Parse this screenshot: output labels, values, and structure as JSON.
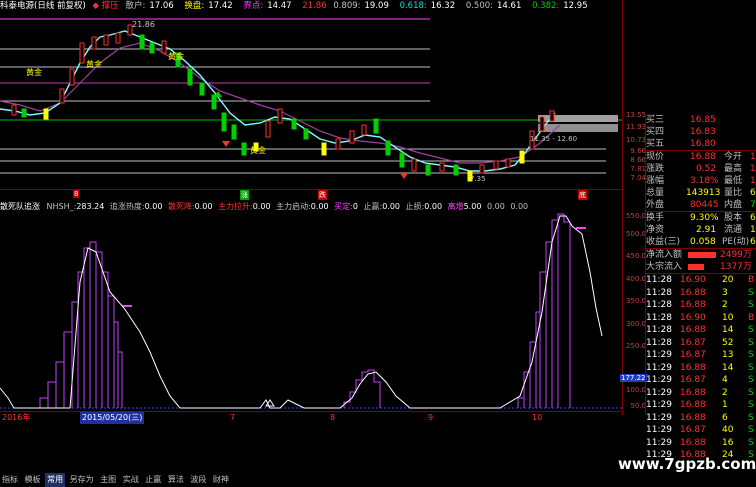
{
  "topbar": {
    "title": "科泰电源(日线 前复权)",
    "pressure": "◆ 撑压",
    "pos_label": "散户:",
    "pos_val": "17.06",
    "chg_label": "换盘:",
    "chg_val": "17.42",
    "line_label": "界点:",
    "line_val": "14.47",
    "ma_val": "21.86",
    "v1_label": "0.809:",
    "v1_val": "19.09",
    "v2_label": "0.618:",
    "v2_val": "16.32",
    "v3_label": "0.500:",
    "v3_val": "14.61",
    "v4_label": "0.382:",
    "v4_val": "12.95"
  },
  "main_chart": {
    "high_label": "21.86",
    "annotations": [
      "黄金",
      "黄金",
      "黄金",
      "黄金"
    ],
    "mid_label": "11.35 - 12.60",
    "low_label": "7.35"
  },
  "signal_row": {
    "sig1": "8",
    "sig2": "涨",
    "sig3": "跌",
    "sig4": "底"
  },
  "indicator": {
    "name": "散死队追涨",
    "nhsh_label": "NHSH_:",
    "nhsh_val": "283.24",
    "heat_label": "追涨热度:",
    "heat_val": "0.00",
    "death_label": "散死降:",
    "death_val": "0.00",
    "pull_label": "主力拉升:",
    "pull_val": "0.00",
    "start_label": "主力启动:",
    "start_val": "0.00",
    "entry_label": "买定:",
    "entry_val": "0",
    "stop_label": "止赢:",
    "stop_val": "0.00",
    "loss_label": "止损:",
    "loss_val": "0.00",
    "fit_label": "离增",
    "fit_val": "5.00",
    "t1": "0.00",
    "t2": "0.00",
    "current_marker": "177.22"
  },
  "price_axis": [
    "13.55",
    "11.93",
    "10.73",
    "9.66",
    "8.66",
    "7.81",
    "7.04"
  ],
  "ind_axis": [
    "550.0",
    "500.0",
    "450.0",
    "400.0",
    "350.0",
    "300.0",
    "250.0",
    "200.0",
    "150.0",
    "100.0",
    "50.0"
  ],
  "date_axis": {
    "year": "2016年",
    "date_box": "2015/05/20(三)",
    "m7": "7",
    "m8": "8",
    "m9": "9",
    "m10": "10"
  },
  "quote_panel": {
    "rows": [
      {
        "label": "买三",
        "value": "16.85",
        "extra": ""
      },
      {
        "label": "买四",
        "value": "16.83",
        "extra": ""
      },
      {
        "label": "买五",
        "value": "16.80",
        "extra": ""
      },
      {
        "label": "现价",
        "value": "16.88",
        "extra": "今开"
      },
      {
        "label": "涨跌",
        "value": "0.52",
        "extra": "最高"
      },
      {
        "label": "涨幅",
        "value": "3.18%",
        "extra": "最低"
      },
      {
        "label": "总量",
        "value": "143913",
        "extra": "量比"
      },
      {
        "label": "外盘",
        "value": "80445",
        "extra": "内盘"
      },
      {
        "label": "换手",
        "value": "9.30%",
        "extra": "股本"
      },
      {
        "label": "净资",
        "value": "2.91",
        "extra": "流通"
      },
      {
        "label": "收益(三)",
        "value": "0.058",
        "extra": "PE(动)"
      },
      {
        "label": "净流入额",
        "value": "2499万",
        "extra": ""
      },
      {
        "label": "大宗流入",
        "value": "1377万",
        "extra": ""
      }
    ],
    "right_edge": [
      "1",
      "1",
      "1",
      "6",
      "7",
      "6",
      "1",
      "6",
      "1",
      "1",
      "1"
    ],
    "trades": [
      {
        "time": "11:28",
        "price": "16.90",
        "vol": "20",
        "side": "B"
      },
      {
        "time": "11:28",
        "price": "16.88",
        "vol": "3",
        "side": "S"
      },
      {
        "time": "11:28",
        "price": "16.88",
        "vol": "2",
        "side": "S"
      },
      {
        "time": "11:28",
        "price": "16.90",
        "vol": "10",
        "side": "B"
      },
      {
        "time": "11:28",
        "price": "16.88",
        "vol": "14",
        "side": "S"
      },
      {
        "time": "11:28",
        "price": "16.87",
        "vol": "52",
        "side": "S"
      },
      {
        "time": "11:29",
        "price": "16.87",
        "vol": "13",
        "side": "S"
      },
      {
        "time": "11:29",
        "price": "16.88",
        "vol": "14",
        "side": "S"
      },
      {
        "time": "11:29",
        "price": "16.87",
        "vol": "4",
        "side": "S"
      },
      {
        "time": "11:29",
        "price": "16.88",
        "vol": "2",
        "side": "S"
      },
      {
        "time": "11:29",
        "price": "16.88",
        "vol": "1",
        "side": "S"
      },
      {
        "time": "11:29",
        "price": "16.88",
        "vol": "6",
        "side": "S"
      },
      {
        "time": "11:29",
        "price": "16.87",
        "vol": "40",
        "side": "S"
      },
      {
        "time": "11:29",
        "price": "16.88",
        "vol": "16",
        "side": "S"
      },
      {
        "time": "11:29",
        "price": "16.88",
        "vol": "24",
        "side": "S"
      }
    ]
  },
  "bottom_tabs": [
    "指标",
    "模板",
    "常用",
    "另存为",
    "主图",
    "实战",
    "止赢",
    "算法",
    "波段",
    "财神"
  ],
  "watermark": "www.7gpzb.com",
  "colors": {
    "up": "#ff3030",
    "down": "#00d000",
    "ma_fast": "#80ffff",
    "ma_slow": "#a040a0",
    "indicator_bar": "#c040ff",
    "indicator_line": "#ffffff"
  }
}
